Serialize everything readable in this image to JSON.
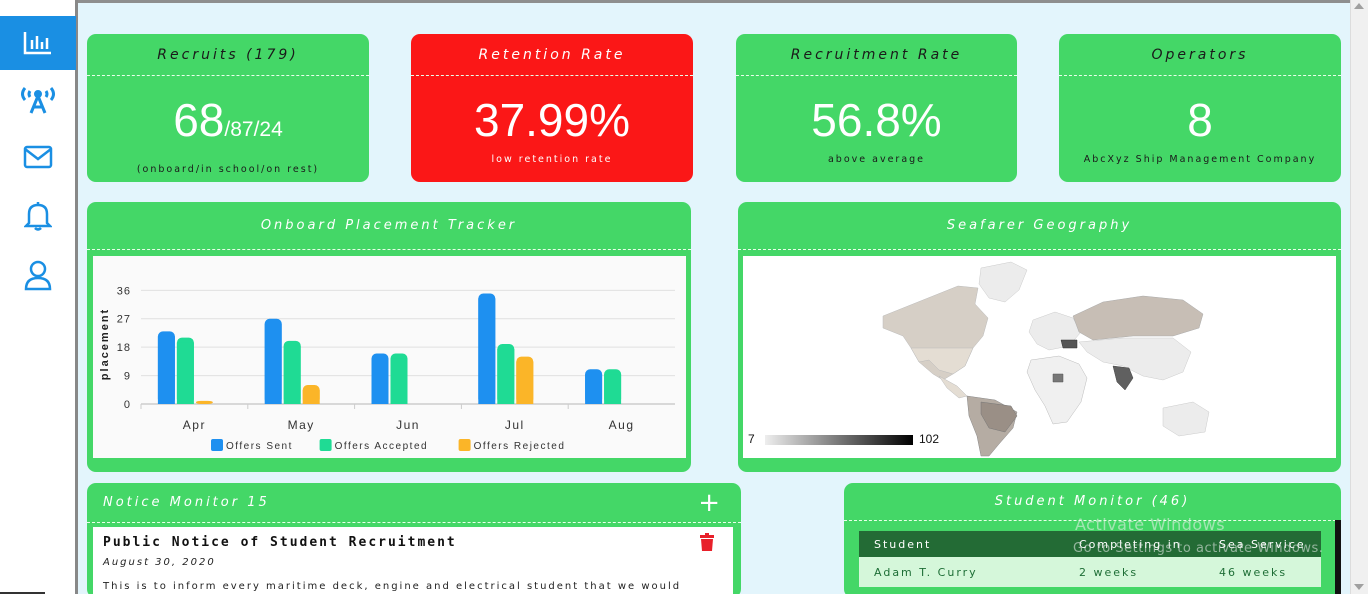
{
  "sidebar": {
    "items": [
      {
        "icon": "bar-chart-icon",
        "active": true
      },
      {
        "icon": "broadcast-tower-icon",
        "active": false
      },
      {
        "icon": "envelope-icon",
        "active": false
      },
      {
        "icon": "bell-icon",
        "active": false
      },
      {
        "icon": "user-icon",
        "active": false
      }
    ]
  },
  "stats": {
    "recruits": {
      "title": "Recruits (179)",
      "main": "68",
      "rest": "/87/24",
      "sub": "(onboard/in school/on rest)"
    },
    "retention": {
      "title": "Retention Rate",
      "main": "37.99%",
      "sub": "low retention rate"
    },
    "recruitment": {
      "title": "Recruitment Rate",
      "main": "56.8%",
      "sub": "above average"
    },
    "operators": {
      "title": "Operators",
      "main": "8",
      "sub": "AbcXyz Ship Management Company"
    }
  },
  "placement": {
    "title": "Onboard Placement Tracker"
  },
  "geography": {
    "title": "Seafarer Geography",
    "legend_min": "7",
    "legend_max": "102"
  },
  "notice": {
    "title": "Notice Monitor 15",
    "add_icon": "plus-icon",
    "item": {
      "title": "Public Notice of Student Recruitment",
      "date": "August 30, 2020",
      "text": "This is to inform every maritime deck, engine and electrical student that we would"
    }
  },
  "students": {
    "title": "Student Monitor (46)",
    "headers": [
      "Student",
      "Completing in",
      "Sea Service"
    ],
    "rows": [
      [
        "Adam T. Curry",
        "2 weeks",
        "46 weeks"
      ]
    ]
  },
  "os_watermark": {
    "line1": "Activate Windows",
    "line2": "Go to Settings to activate Windows."
  },
  "colors": {
    "card_green": "#44d767",
    "card_red": "#fb1717",
    "accent_blue": "#1a8fe3",
    "series_sent": "#1e90f0",
    "series_accepted": "#1fdb94",
    "series_rejected": "#fbb528"
  },
  "chart_data": {
    "type": "bar",
    "title": "",
    "xlabel": "",
    "ylabel": "placement",
    "categories": [
      "Apr",
      "May",
      "Jun",
      "Jul",
      "Aug"
    ],
    "yticks": [
      "0",
      "9",
      "18",
      "27",
      "36"
    ],
    "ylim": [
      0,
      38
    ],
    "grid": true,
    "legend_position": "bottom",
    "series": [
      {
        "name": "Offers Sent",
        "values": [
          23,
          27,
          16,
          35,
          11
        ]
      },
      {
        "name": "Offers Accepted",
        "values": [
          21,
          20,
          16,
          19,
          11
        ]
      },
      {
        "name": "Offers Rejected",
        "values": [
          1,
          6,
          0,
          15,
          0
        ]
      }
    ]
  }
}
